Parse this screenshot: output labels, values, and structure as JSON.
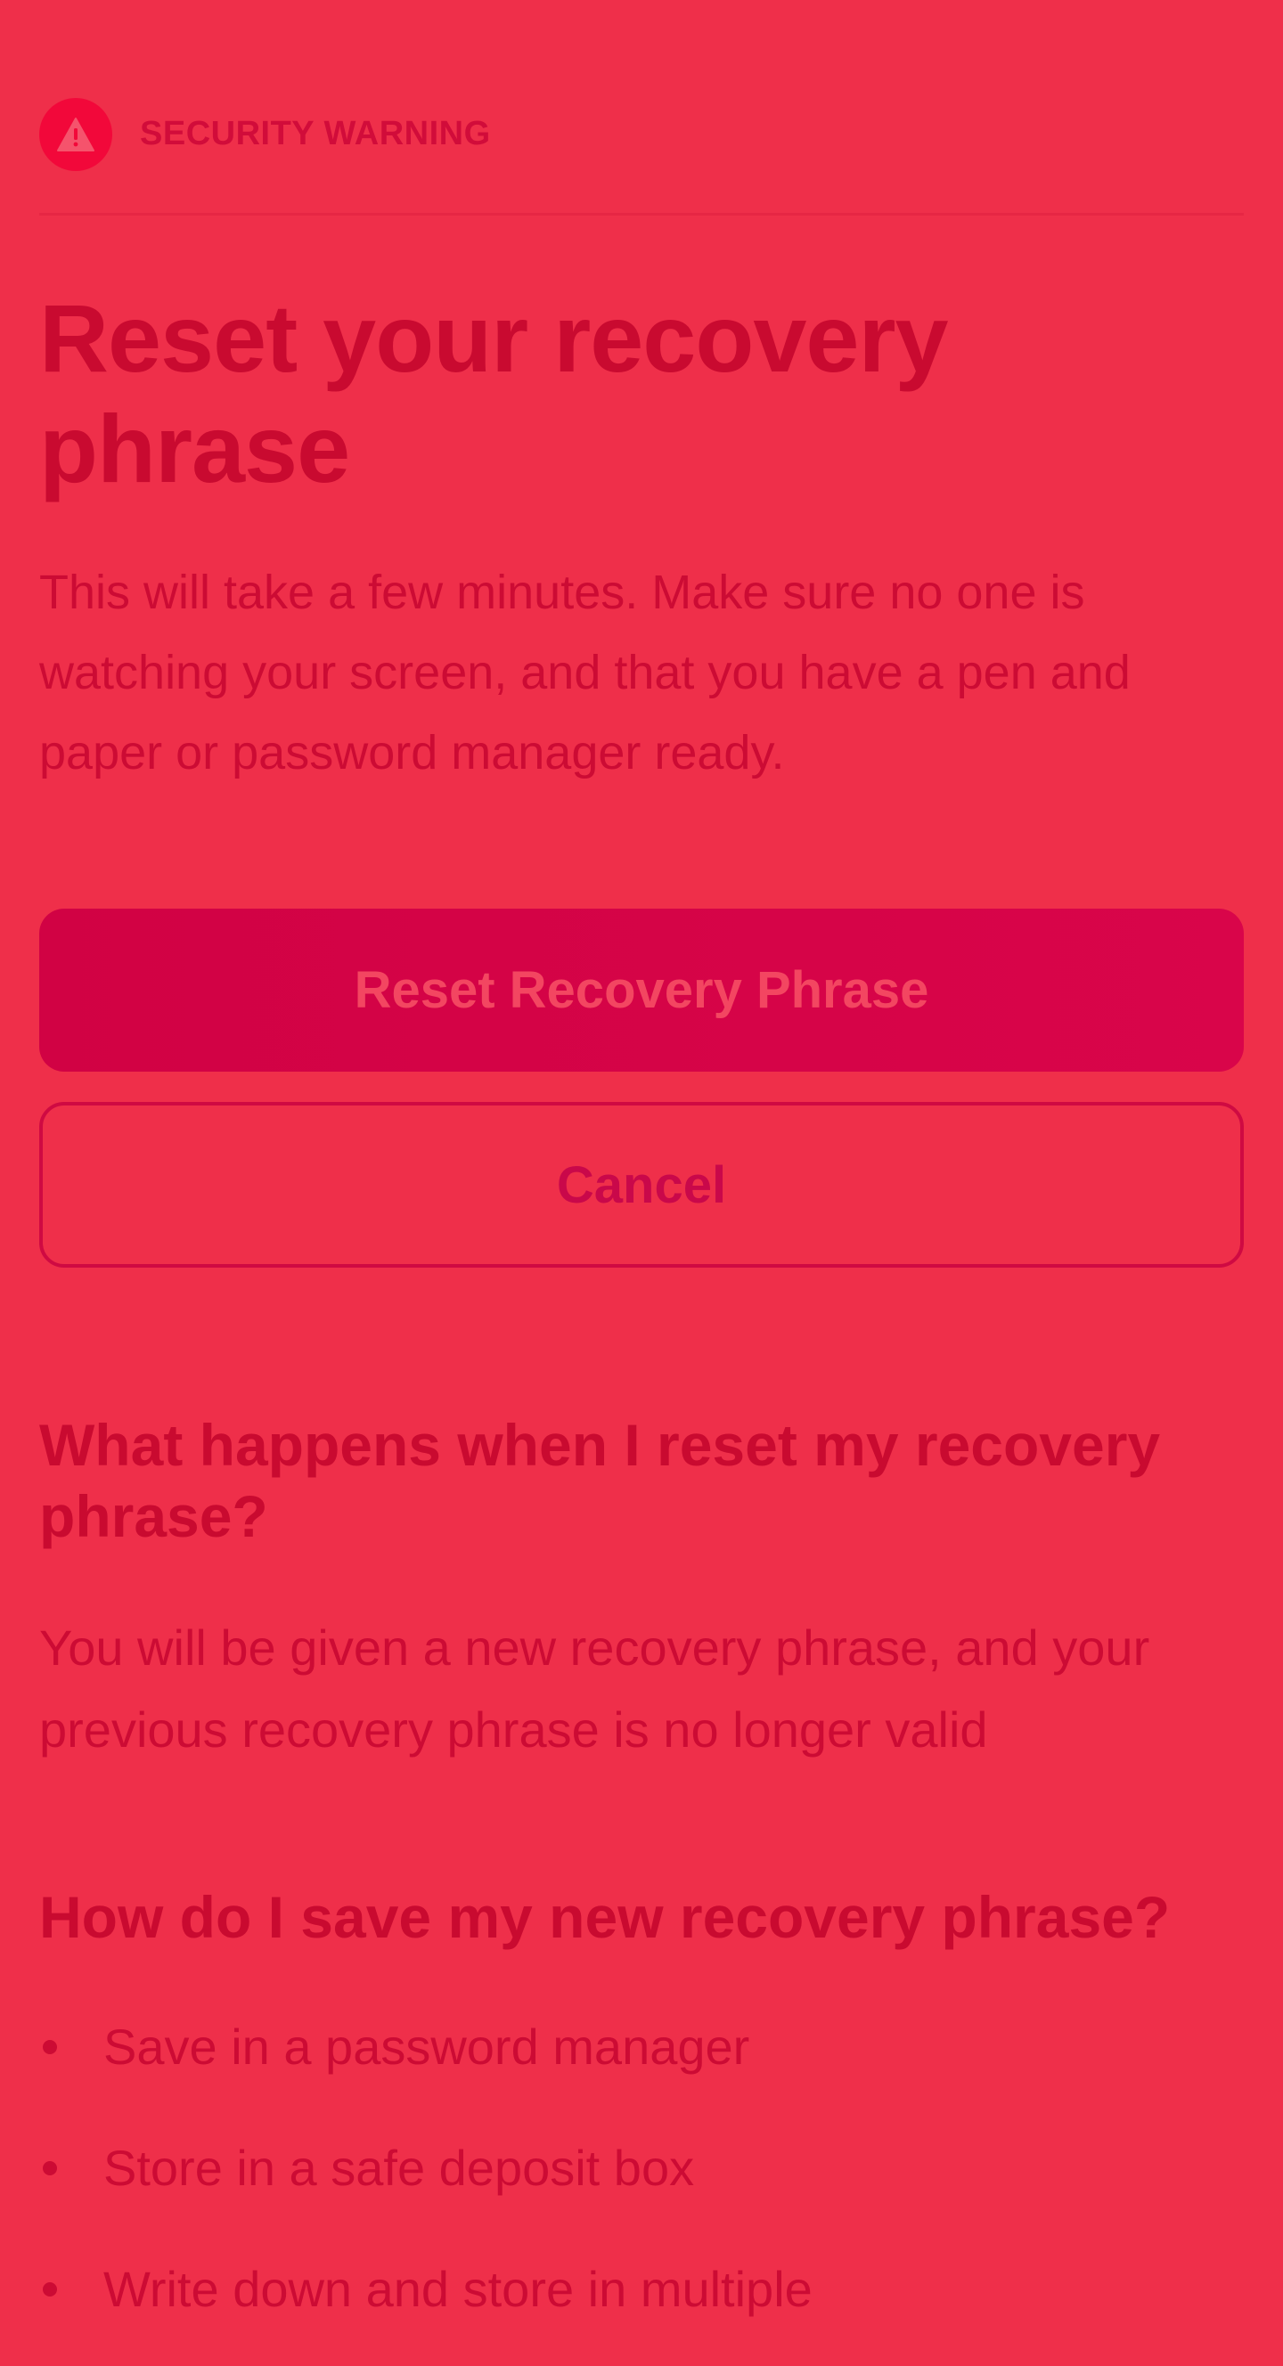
{
  "header": {
    "label": "SECURITY WARNING",
    "icon": "warning-triangle-icon"
  },
  "title": "Reset your recovery phrase",
  "intro": "This will take a few minutes. Make sure no one is watching your screen, and that you have a pen and paper or password manager ready.",
  "actions": {
    "primary_label": "Reset Recovery Phrase",
    "secondary_label": "Cancel"
  },
  "faq": {
    "q1": "What happens when I reset my recovery phrase?",
    "a1": "You will be given a new recovery phrase, and your previous recovery phrase is no longer valid",
    "q2": "How do I save my new recovery phrase?",
    "bullets": [
      "Save in a password manager",
      "Store in a safe deposit box",
      "Write down and store in multiple"
    ]
  },
  "colors": {
    "background": "#ef2f4a",
    "accent": "#d10244",
    "text": "#cc0b34"
  }
}
